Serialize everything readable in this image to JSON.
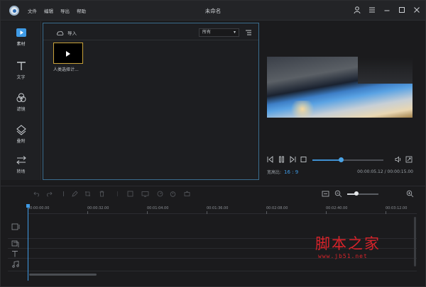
{
  "app": {
    "title": "未命名",
    "menu": [
      "文件",
      "编辑",
      "导出",
      "帮助"
    ]
  },
  "nav": {
    "items": [
      {
        "label": "素材",
        "icon": "play-tile-icon",
        "active": true
      },
      {
        "label": "文字",
        "icon": "text-t-icon"
      },
      {
        "label": "滤镜",
        "icon": "filter-circles-icon"
      },
      {
        "label": "叠附",
        "icon": "overlay-layers-icon"
      },
      {
        "label": "转场",
        "icon": "transition-arrows-icon"
      }
    ]
  },
  "media": {
    "import_label": "导入",
    "filter_value": "所有",
    "items": [
      {
        "name": "人类选择计..."
      }
    ]
  },
  "preview": {
    "ratio_label": "宽高比:",
    "ratio_value": "16 : 9",
    "time": "00:00:05.12 / 00:00:15.00",
    "progress": 0.4
  },
  "timeline": {
    "ruler_ticks": [
      "00:00:00.00",
      "00:00:32.00",
      "00:01:04.00",
      "00:01:36.00",
      "00:02:08.00",
      "00:02:40.00",
      "00:03:12.00"
    ],
    "zoom_level": 0.3
  },
  "watermark": {
    "line1": "脚本之家",
    "line2": "www.jb51.net"
  },
  "colors": {
    "accent": "#3f9be6",
    "panel_border": "#3a6c8e",
    "watermark": "#d8232a",
    "thumb_border": "#c9a23a"
  }
}
